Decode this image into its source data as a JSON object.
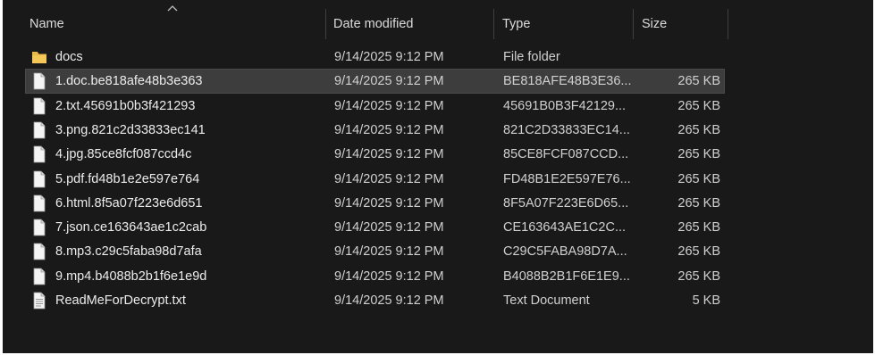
{
  "columns": {
    "name": "Name",
    "date": "Date modified",
    "type": "Type",
    "size": "Size"
  },
  "sort": {
    "column": "Name",
    "icon": "chevron-up-icon"
  },
  "icons": {
    "folder": "folder-icon",
    "file": "file-icon",
    "text_file": "text-document-icon"
  },
  "colors": {
    "background": "#191919",
    "text": "#ececec",
    "selection": "#3d3d3d",
    "folder": "#e8b848"
  },
  "files": [
    {
      "name": "docs",
      "date": "9/14/2025 9:12 PM",
      "type": "File folder",
      "size": "",
      "icon": "folder-icon"
    },
    {
      "name": "1.doc.be818afe48b3e363",
      "date": "9/14/2025 9:12 PM",
      "type": "BE818AFE48B3E36...",
      "size": "265 KB",
      "icon": "file-icon",
      "selected": true
    },
    {
      "name": "2.txt.45691b0b3f421293",
      "date": "9/14/2025 9:12 PM",
      "type": "45691B0B3F42129...",
      "size": "265 KB",
      "icon": "file-icon"
    },
    {
      "name": "3.png.821c2d33833ec141",
      "date": "9/14/2025 9:12 PM",
      "type": "821C2D33833EC14...",
      "size": "265 KB",
      "icon": "file-icon"
    },
    {
      "name": "4.jpg.85ce8fcf087ccd4c",
      "date": "9/14/2025 9:12 PM",
      "type": "85CE8FCF087CCD...",
      "size": "265 KB",
      "icon": "file-icon"
    },
    {
      "name": "5.pdf.fd48b1e2e597e764",
      "date": "9/14/2025 9:12 PM",
      "type": "FD48B1E2E597E76...",
      "size": "265 KB",
      "icon": "file-icon"
    },
    {
      "name": "6.html.8f5a07f223e6d651",
      "date": "9/14/2025 9:12 PM",
      "type": "8F5A07F223E6D65...",
      "size": "265 KB",
      "icon": "file-icon"
    },
    {
      "name": "7.json.ce163643ae1c2cab",
      "date": "9/14/2025 9:12 PM",
      "type": "CE163643AE1C2C...",
      "size": "265 KB",
      "icon": "file-icon"
    },
    {
      "name": "8.mp3.c29c5faba98d7afa",
      "date": "9/14/2025 9:12 PM",
      "type": "C29C5FABA98D7A...",
      "size": "265 KB",
      "icon": "file-icon"
    },
    {
      "name": "9.mp4.b4088b2b1f6e1e9d",
      "date": "9/14/2025 9:12 PM",
      "type": "B4088B2B1F6E1E9...",
      "size": "265 KB",
      "icon": "file-icon"
    },
    {
      "name": "ReadMeForDecrypt.txt",
      "date": "9/14/2025 9:12 PM",
      "type": "Text Document",
      "size": "5 KB",
      "icon": "text-document-icon"
    }
  ]
}
